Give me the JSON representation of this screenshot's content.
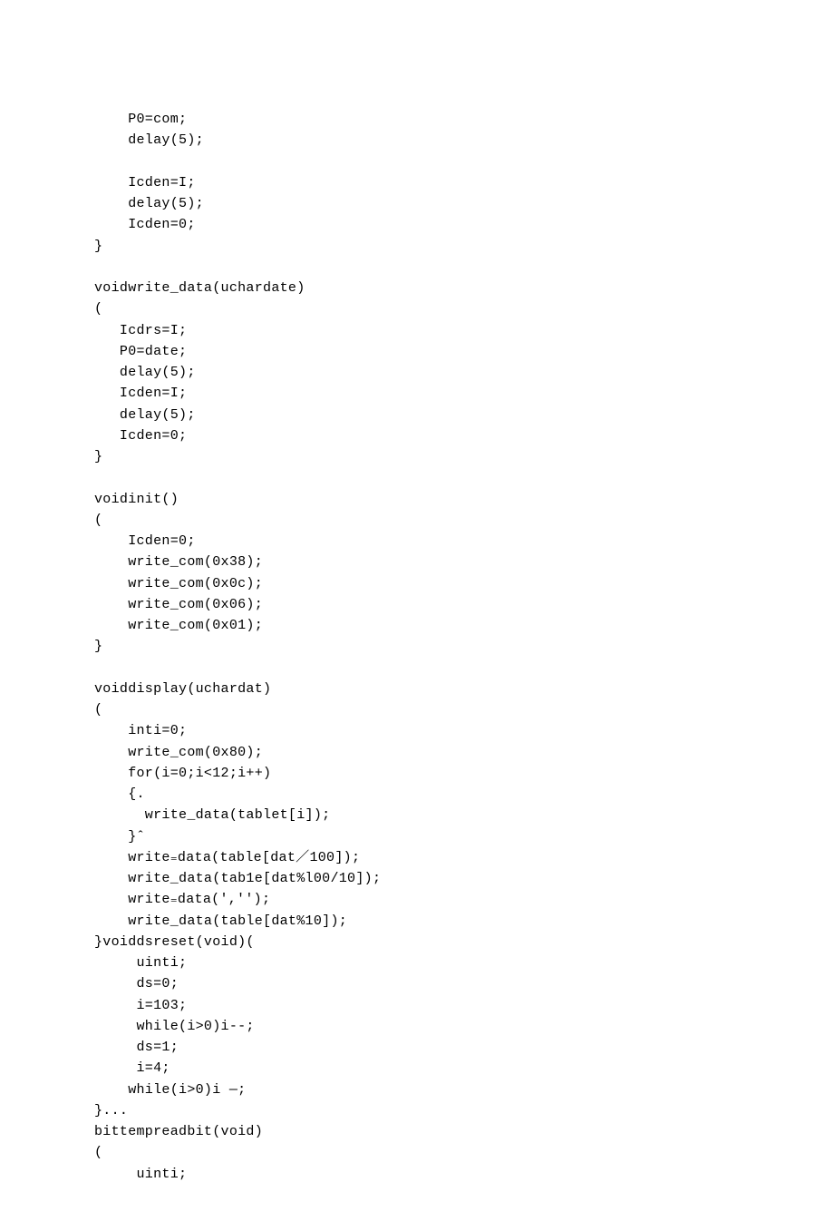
{
  "code": {
    "lines": [
      "    P0=com;",
      "    delay(5);",
      "",
      "    Icden=I;",
      "    delay(5);",
      "    Icden=0;",
      "}",
      "",
      "voidwrite_data(uchardate)",
      "(",
      "   Icdrs=I;",
      "   P0=date;",
      "   delay(5);",
      "   Icden=I;",
      "   delay(5);",
      "   Icden=0;",
      "}",
      "",
      "voidinit()",
      "(",
      "    Icden=0;",
      "    write_com(0x38);",
      "    write_com(0x0c);",
      "    write_com(0x06);",
      "    write_com(0x01);",
      "}",
      "",
      "voiddisplay(uchardat)",
      "(",
      "    inti=0;",
      "    write_com(0x80);",
      "    for(i=0;i<12;i++)",
      "    {.",
      "      write_data(tablet[i]);",
      "    }ˆ",
      "    write₌data(table[dat／100]);",
      "    write_data(tab1e[dat%l00/10]);",
      "    write₌data(','');",
      "    write_data(table[dat%10]);",
      "}voiddsreset(void)(",
      "     uinti;",
      "     ds=0;",
      "     i=103;",
      "     while(i>0)i--;",
      "     ds=1;",
      "     i=4;",
      "    while(i>0)i —;",
      "}...",
      "bittempreadbit(void)",
      "(",
      "     uinti;"
    ]
  }
}
